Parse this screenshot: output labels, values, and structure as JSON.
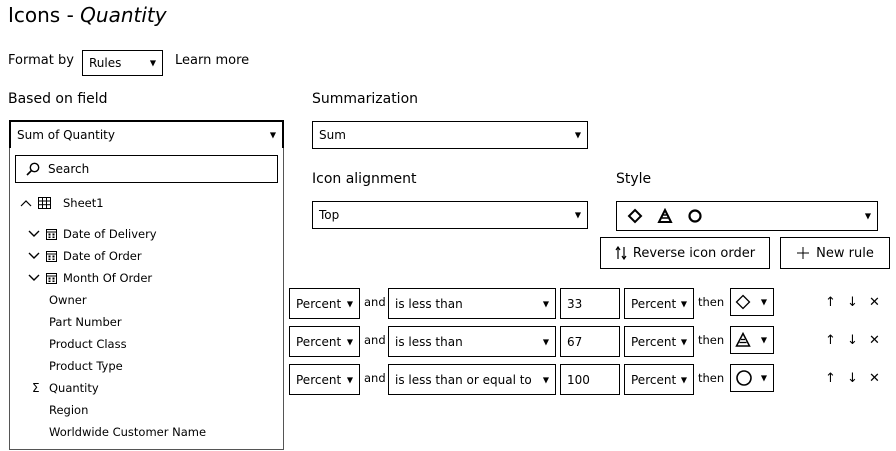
{
  "header": {
    "title_prefix": "Icons - ",
    "title_field": "Quantity"
  },
  "format_by": {
    "label": "Format by",
    "value": "Rules",
    "learn_more": "Learn more"
  },
  "based_on": {
    "label": "Based on field",
    "value": "Sum of Quantity"
  },
  "summarization": {
    "label": "Summarization",
    "value": "Sum"
  },
  "icon_alignment": {
    "label": "Icon alignment",
    "value": "Top"
  },
  "style": {
    "label": "Style"
  },
  "buttons": {
    "reverse": "Reverse icon order",
    "new_rule": "New rule"
  },
  "dropdown": {
    "search_placeholder": "Search",
    "root": "Sheet1",
    "items": [
      "Date of Delivery",
      "Date of Order",
      "Month Of Order",
      "Owner",
      "Part Number",
      "Product Class",
      "Product Type",
      "Quantity",
      "Region",
      "Worldwide Customer Name"
    ]
  },
  "rules": [
    {
      "unit1": "Percent",
      "and": "and",
      "op": "is less than",
      "value": "33",
      "unit2": "Percent",
      "then": "then",
      "icon": "diamond-icon"
    },
    {
      "unit1": "Percent",
      "and": "and",
      "op": "is less than",
      "value": "67",
      "unit2": "Percent",
      "then": "then",
      "icon": "triangle-icon"
    },
    {
      "unit1": "Percent",
      "and": "and",
      "op": "is less than or equal to",
      "value": "100",
      "unit2": "Percent",
      "then": "then",
      "icon": "circle-icon"
    }
  ]
}
